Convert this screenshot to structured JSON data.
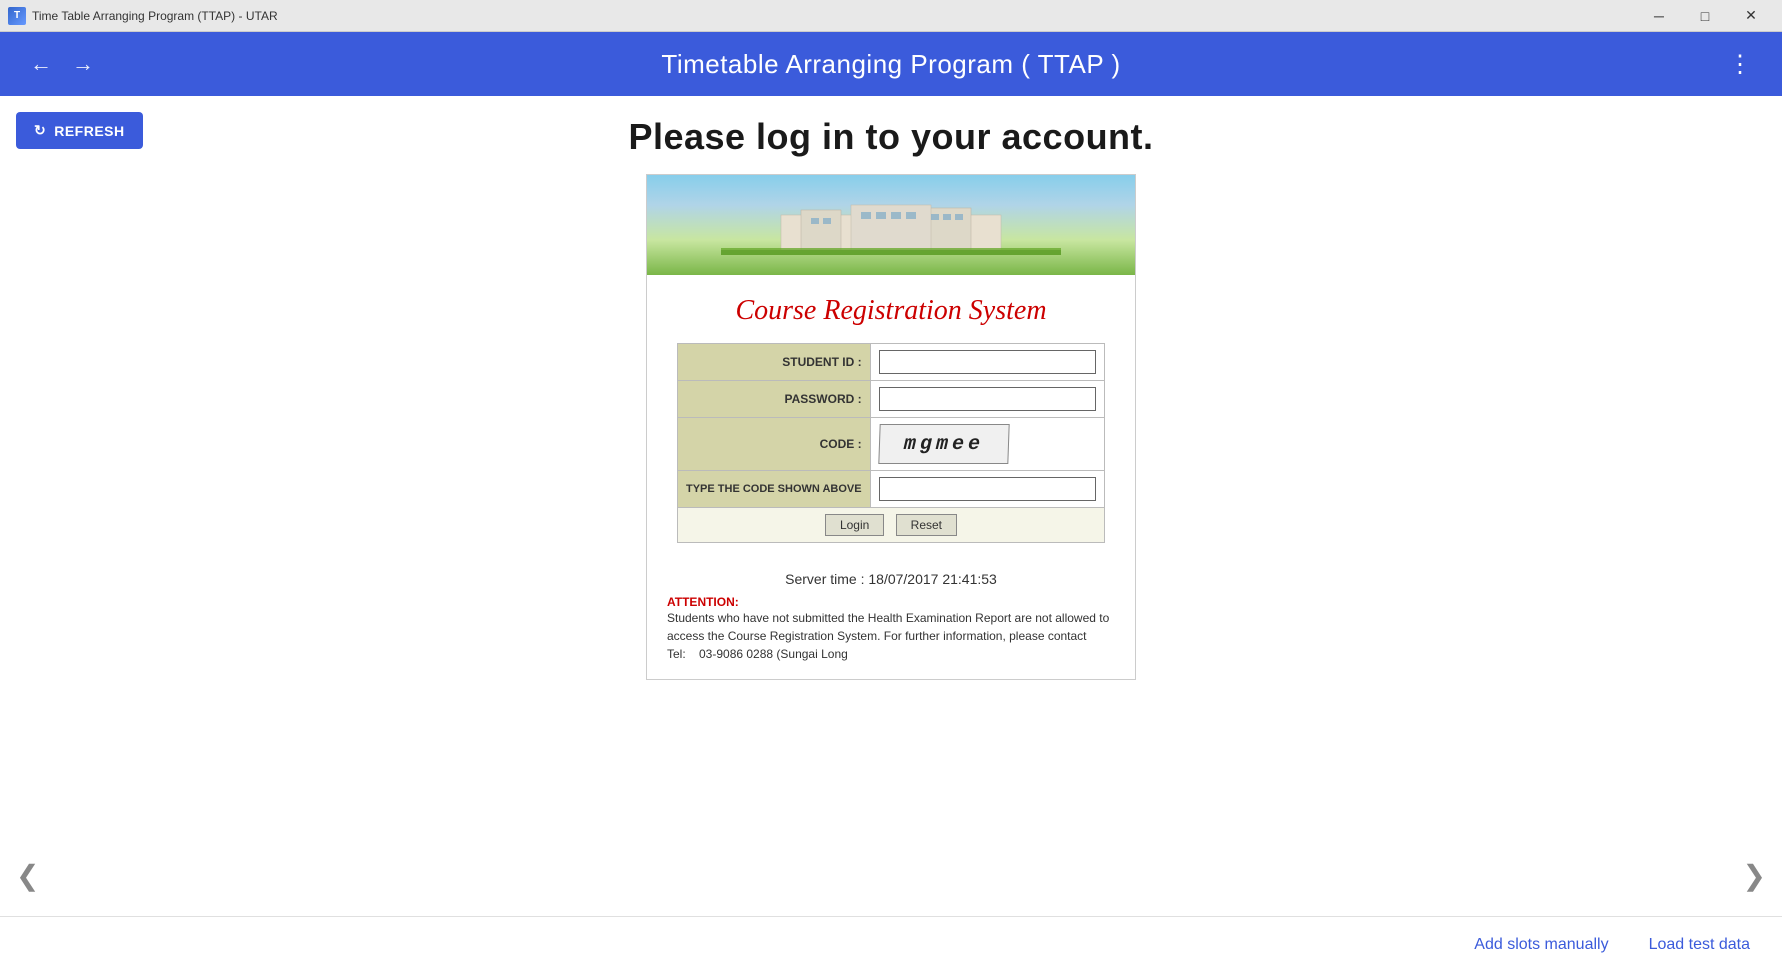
{
  "titlebar": {
    "icon_label": "T",
    "title": "Time Table Arranging Program (TTAP) - UTAR",
    "min_label": "─",
    "max_label": "□",
    "close_label": "✕"
  },
  "header": {
    "back_arrow": "←",
    "forward_arrow": "→",
    "title": "Timetable Arranging Program ( TTAP )",
    "menu_icon": "⋮"
  },
  "main": {
    "refresh_icon": "↻",
    "refresh_label": "REFRESH",
    "page_heading": "Please log in to your account.",
    "course_title": "Course Registration System",
    "form": {
      "student_id_label": "STUDENT ID :",
      "password_label": "PASSWORD :",
      "code_label": "CODE :",
      "type_code_label": "TYPE THE CODE SHOWN ABOVE",
      "captcha_text": "mgmee",
      "login_btn": "Login",
      "reset_btn": "Reset"
    },
    "server_time_label": "Server time : 18/07/2017 21:41:53",
    "attention": {
      "title": "ATTENTION:",
      "text": "Students who have not submitted the Health Examination Report are not allowed to access the Course Registration System. For further information, please contact\nTel:    03-9086 0288 (Sungai Long"
    },
    "nav_left": "❮",
    "nav_right": "❯"
  },
  "bottom": {
    "add_slots_label": "Add slots manually",
    "load_test_label": "Load test data"
  }
}
